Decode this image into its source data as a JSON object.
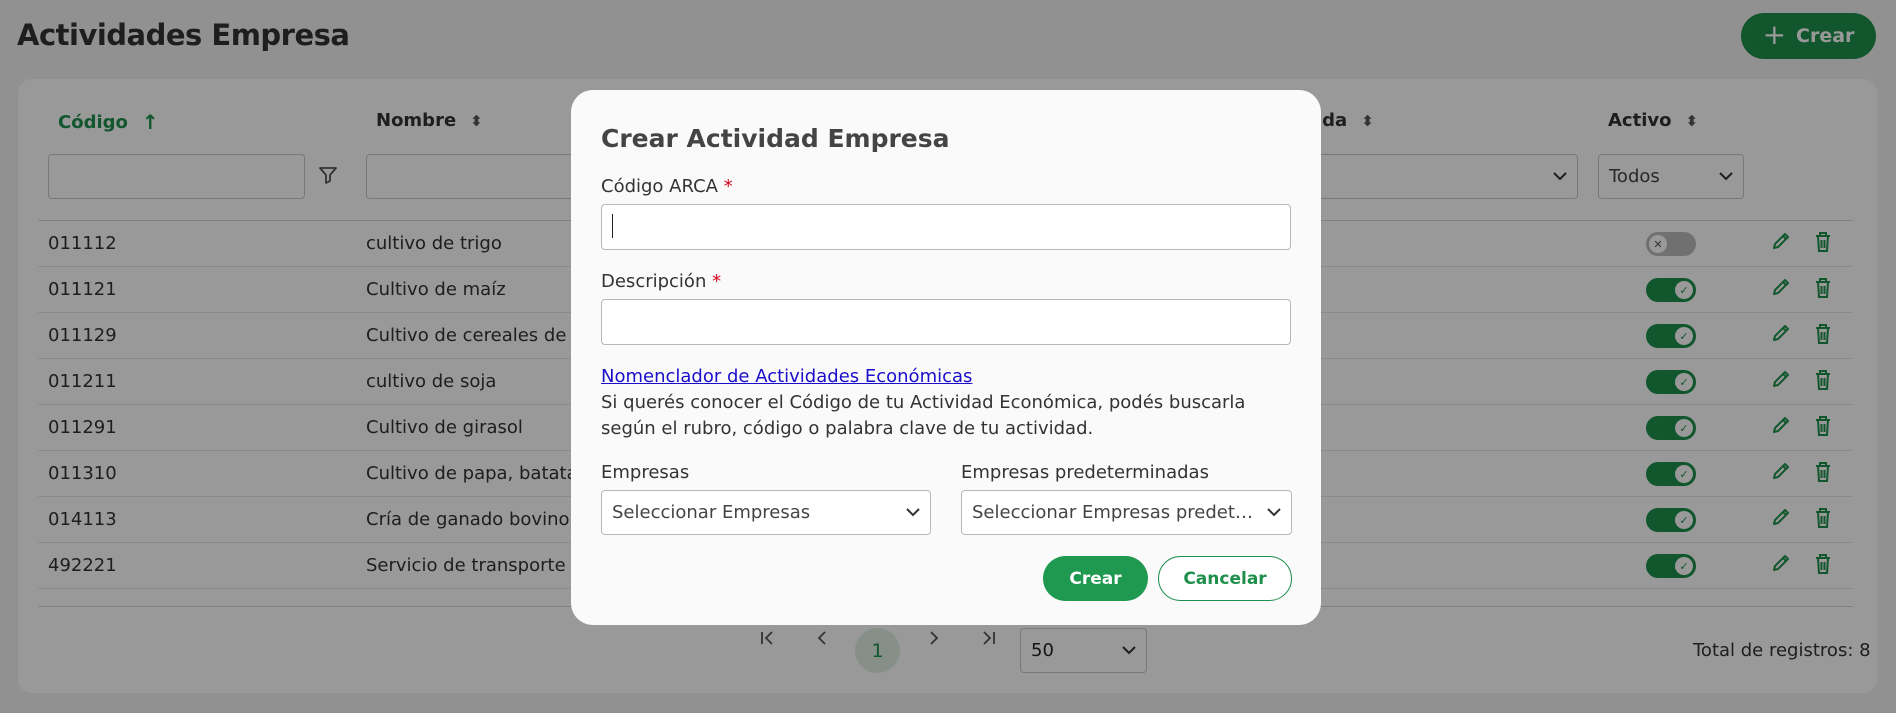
{
  "page": {
    "title": "Actividades Empresa",
    "create_label": "Crear",
    "plus_icon": "+",
    "columns": {
      "codigo": "Código",
      "nombre": "Nombre",
      "predeterminada": "ada",
      "activo": "Activo"
    },
    "filters": {
      "activo_value": "Todos"
    },
    "rows": [
      {
        "code": "011112",
        "name": "cultivo de trigo",
        "active": false
      },
      {
        "code": "011121",
        "name": "Cultivo de maíz",
        "active": true
      },
      {
        "code": "011129",
        "name": "Cultivo de cereales de uso",
        "active": true
      },
      {
        "code": "011211",
        "name": "cultivo de soja",
        "active": true
      },
      {
        "code": "011291",
        "name": "Cultivo de girasol",
        "active": true
      },
      {
        "code": "011310",
        "name": "Cultivo de papa, batata y",
        "active": true
      },
      {
        "code": "014113",
        "name": "Cría de ganado bovino, ex",
        "active": true
      },
      {
        "code": "492221",
        "name": "Servicio de transporte au",
        "active": true
      }
    ],
    "pagination": {
      "current_page": "1",
      "page_size": "50",
      "total": "Total de registros: 8"
    }
  },
  "modal": {
    "title": "Crear Actividad Empresa",
    "codigo_label": "Código ARCA",
    "descripcion_label": "Descripción",
    "required_mark": "*",
    "codigo_value": "",
    "descripcion_value": "",
    "link_text": "Nomenclador de Actividades Económicas",
    "help_text": "Si querés conocer el Código de tu Actividad Económica, podés buscarla según el rubro, código o palabra clave de tu actividad.",
    "empresas_label": "Empresas",
    "empresas_placeholder": "Seleccionar Empresas",
    "predeterminadas_label": "Empresas predeterminadas",
    "predeterminadas_placeholder": "Seleccionar Empresas predetermi...",
    "submit_label": "Crear",
    "cancel_label": "Cancelar"
  },
  "colors": {
    "accent": "#1f8f4c",
    "link": "#1a0dcc",
    "required": "#d0021b"
  }
}
